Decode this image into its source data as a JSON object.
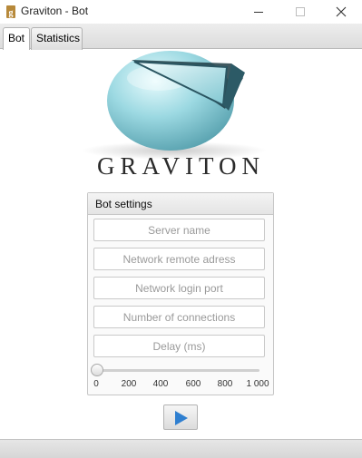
{
  "window": {
    "title": "Graviton - Bot",
    "app_icon": "graviton-g-icon",
    "controls": [
      "minimize-icon",
      "maximize-icon",
      "close-icon"
    ]
  },
  "tabs": [
    {
      "label": "Bot",
      "selected": true
    },
    {
      "label": "Statistics",
      "selected": false
    }
  ],
  "brand": {
    "name": "GRAVITON",
    "logo": "graviton-sphere-logo"
  },
  "bot_settings": {
    "title": "Bot settings",
    "fields": [
      {
        "placeholder": "Server name",
        "value": ""
      },
      {
        "placeholder": "Network remote adress",
        "value": ""
      },
      {
        "placeholder": "Network login port",
        "value": ""
      },
      {
        "placeholder": "Number of connections",
        "value": ""
      },
      {
        "placeholder": "Delay (ms)",
        "value": ""
      }
    ],
    "slider": {
      "min": 0,
      "max": 1000,
      "value": 0,
      "ticks": [
        "0",
        "200",
        "400",
        "600",
        "800",
        "1 000"
      ]
    }
  },
  "actions": {
    "start_icon": "play-icon"
  },
  "colors": {
    "accent": "#2f7fd0",
    "logo_teal": "#8fd3dc"
  }
}
